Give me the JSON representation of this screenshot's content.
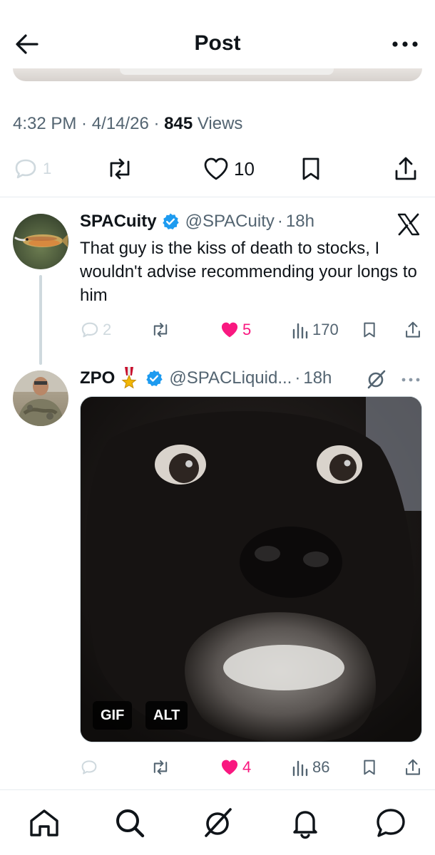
{
  "header": {
    "title": "Post"
  },
  "post_meta": {
    "time": "4:32 PM",
    "date": "4/14/26",
    "views_count": "845",
    "views_label": "Views"
  },
  "post_stats": {
    "replies": "1",
    "likes": "10"
  },
  "replies": [
    {
      "name": "SPACuity",
      "handle": "@SPACuity",
      "time": "18h",
      "text": "That guy is the kiss of death to stocks, I wouldn't advise recommending your longs to him",
      "replies": "2",
      "likes": "5",
      "views": "170"
    },
    {
      "name": "ZPO",
      "handle": "@SPACLiquid...",
      "time": "18h",
      "media_badges": {
        "gif": "GIF",
        "alt": "ALT"
      },
      "likes": "4",
      "views": "86"
    }
  ],
  "colors": {
    "accent": "#1d9bf0",
    "like": "#f91880",
    "muted": "#536471",
    "text": "#0f1419"
  }
}
